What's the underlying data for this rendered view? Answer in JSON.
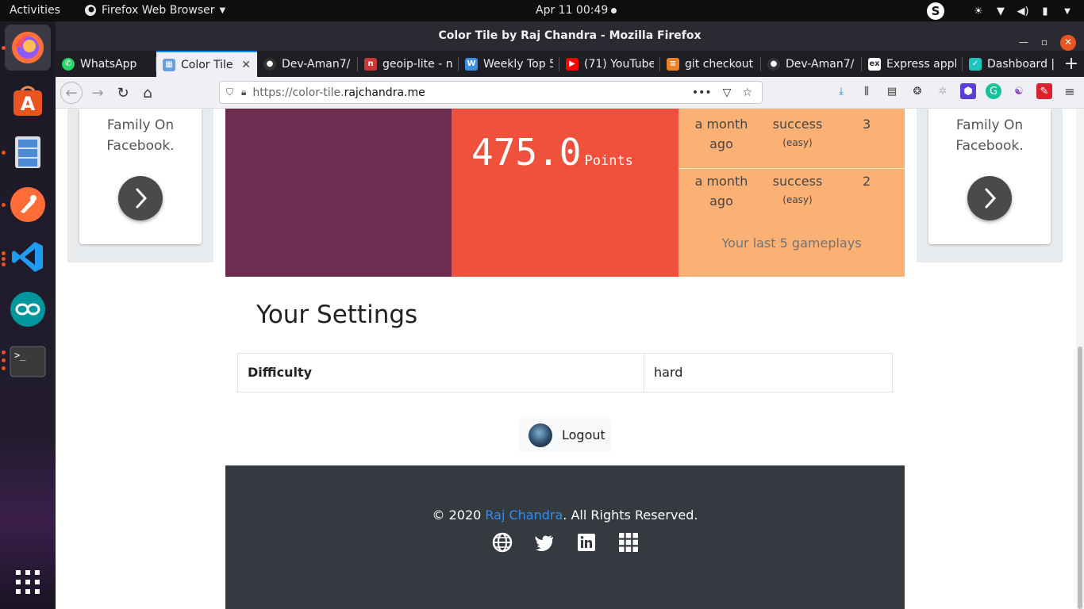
{
  "system": {
    "activities": "Activities",
    "app_menu": "Firefox Web Browser",
    "clock": "Apr 11  00:49"
  },
  "window": {
    "title": "Color Tile by Raj Chandra - Mozilla Firefox"
  },
  "tabs": [
    {
      "label": "WhatsApp",
      "favicon_color": "#25d366",
      "icon": "whatsapp-icon"
    },
    {
      "label": "Color Tile",
      "favicon_color": "#6aa0e0",
      "icon": "color-tile-icon"
    },
    {
      "label": "Dev-Aman7/",
      "favicon_color": "#333333",
      "icon": "github-icon"
    },
    {
      "label": "geoip-lite - n",
      "favicon_color": "#cb3837",
      "icon": "npm-icon"
    },
    {
      "label": "Weekly Top 5",
      "favicon_color": "#3a8ee6",
      "icon": "weekly-icon"
    },
    {
      "label": "(71) YouTube",
      "favicon_color": "#ff0000",
      "icon": "youtube-icon"
    },
    {
      "label": "git checkout",
      "favicon_color": "#f48024",
      "icon": "stackoverflow-icon"
    },
    {
      "label": "Dev-Aman7/",
      "favicon_color": "#333333",
      "icon": "github-icon"
    },
    {
      "label": "Express appl",
      "favicon_color": "#444444",
      "icon": "express-icon"
    },
    {
      "label": "Dashboard |",
      "favicon_color": "#1bc5bd",
      "icon": "dashboard-icon"
    }
  ],
  "url": {
    "prefix": "https://color-tile.",
    "host": "rajchandra.me"
  },
  "page": {
    "side_text_line1": "Family On",
    "side_text_line2": "Facebook.",
    "points_value": "475.0",
    "points_unit": "Points",
    "gameplays": [
      {
        "when_line1": "a month",
        "when_line2": "ago",
        "result": "success",
        "difficulty": "(easy)",
        "score": "3"
      },
      {
        "when_line1": "a month",
        "when_line2": "ago",
        "result": "success",
        "difficulty": "(easy)",
        "score": "2"
      }
    ],
    "gameplays_caption": "Your last 5 gameplays",
    "settings_title": "Your Settings",
    "settings": [
      {
        "key": "Difficulty",
        "value": "hard"
      }
    ],
    "logout_label": "Logout",
    "footer_prefix": "© 2020 ",
    "footer_link": "Raj Chandra",
    "footer_suffix": ". All Rights Reserved."
  },
  "colors": {
    "tile_purple": "#6f2c51",
    "tile_red": "#f0513c",
    "tile_orange": "#fbb173",
    "footer_bg": "#343a40",
    "link": "#2f8ff0"
  }
}
